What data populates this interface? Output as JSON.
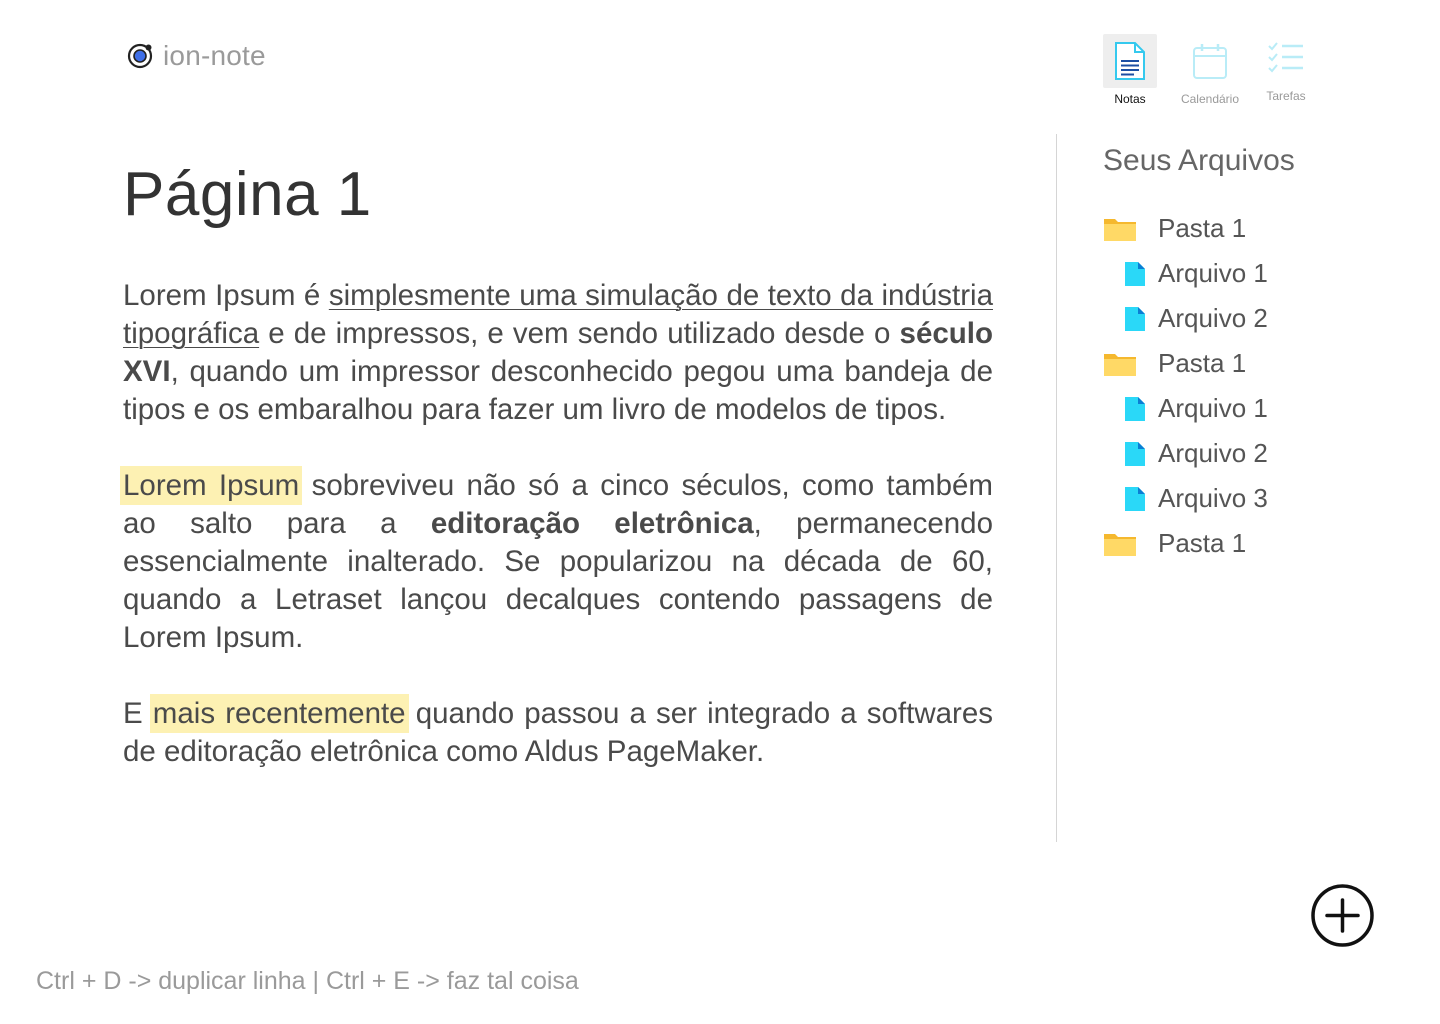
{
  "app": {
    "name": "ion-note",
    "logo_icon": "ionic-logo-icon",
    "accent_color": "#3880ff"
  },
  "nav": {
    "items": [
      {
        "label": "Notas",
        "icon": "document-icon",
        "active": true
      },
      {
        "label": "Calendário",
        "icon": "calendar-icon",
        "active": false
      },
      {
        "label": "Tarefas",
        "icon": "checklist-icon",
        "active": false
      }
    ]
  },
  "document": {
    "title": "Página 1",
    "paragraphs": [
      {
        "t1": "Lorem Ipsum é ",
        "u1": "simplesmente uma simulação de texto da indústria tipográfica",
        "t2": " e de impressos, e vem sendo utilizado desde o ",
        "b1": "século XVI",
        "t3": ", quando um impressor desconhecido pegou uma bandeja de tipos e os embaralhou para fazer um livro de modelos de tipos."
      },
      {
        "h1": "Lorem Ipsum",
        "t1": " sobreviveu não só a cinco séculos, como também ao salto para a ",
        "b1": "editoração eletrônica",
        "t2": ", permanecendo essencialmente inalterado. Se popularizou na década de 60, quando a Letraset lançou decalques contendo passagens de Lorem Ipsum."
      },
      {
        "t1": "E ",
        "h1": "mais recentemente",
        "t2": " quando passou a ser integrado a softwares de editoração eletrônica como Aldus PageMaker."
      }
    ],
    "highlight_color": "#fdf1b3"
  },
  "sidebar": {
    "title": "Seus Arquivos",
    "items": [
      {
        "type": "folder",
        "label": "Pasta 1",
        "icon": "folder-icon"
      },
      {
        "type": "file",
        "label": "Arquivo 1",
        "icon": "file-icon"
      },
      {
        "type": "file",
        "label": "Arquivo 2",
        "icon": "file-icon"
      },
      {
        "type": "folder",
        "label": "Pasta 1",
        "icon": "folder-icon"
      },
      {
        "type": "file",
        "label": "Arquivo 1",
        "icon": "file-icon"
      },
      {
        "type": "file",
        "label": "Arquivo 2",
        "icon": "file-icon"
      },
      {
        "type": "file",
        "label": "Arquivo 3",
        "icon": "file-icon"
      },
      {
        "type": "folder",
        "label": "Pasta 1",
        "icon": "folder-icon"
      }
    ],
    "folder_color": "#ffd24d",
    "file_color": "#2ad8f8"
  },
  "actions": {
    "add_icon": "add-circle-icon"
  },
  "footer": {
    "shortcuts": "Ctrl + D -> duplicar linha | Ctrl + E -> faz tal coisa"
  }
}
